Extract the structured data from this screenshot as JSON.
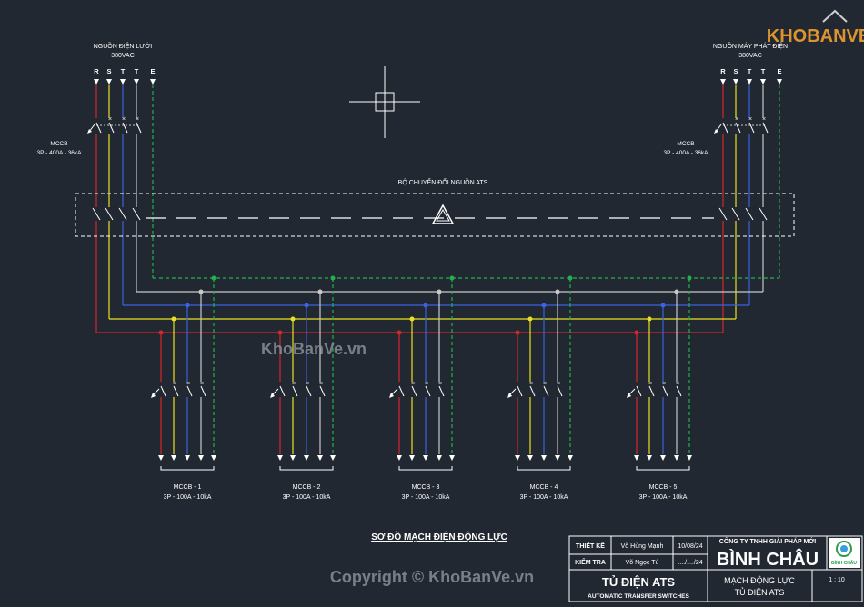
{
  "colors": {
    "background": "#222831",
    "R": "#d7262b",
    "S": "#e8e021",
    "T1": "#3b62e0",
    "T2": "#c8c8c8",
    "E": "#22b14c",
    "frame": "#ffffff"
  },
  "left_source": {
    "title": "NGUỒN ĐIỆN LƯỚI",
    "voltage": "380VAC",
    "phases": [
      "R",
      "S",
      "T",
      "T",
      "E"
    ],
    "breaker_name": "MCCB",
    "breaker_rating": "3P - 400A - 36kA"
  },
  "right_source": {
    "title": "NGUỒN MÁY PHÁT ĐIỆN",
    "voltage": "380VAC",
    "phases": [
      "R",
      "S",
      "T",
      "T",
      "E"
    ],
    "breaker_name": "MCCB",
    "breaker_rating": "3P - 400A - 36kA"
  },
  "ats_label": "BỘ CHUYỂN ĐỔI NGUỒN ATS",
  "outputs": [
    {
      "name": "MCCB - 1",
      "rating": "3P - 100A - 10kA"
    },
    {
      "name": "MCCB - 2",
      "rating": "3P - 100A - 10kA"
    },
    {
      "name": "MCCB - 3",
      "rating": "3P - 100A - 10kA"
    },
    {
      "name": "MCCB - 4",
      "rating": "3P - 100A - 10kA"
    },
    {
      "name": "MCCB - 5",
      "rating": "3P - 100A - 10kA"
    }
  ],
  "diagram_title": "SƠ ĐỒ MẠCH ĐIỆN ĐỘNG LỰC",
  "title_block": {
    "designer_label": "THIẾT KẾ",
    "designer_name": "Võ Hùng Mạnh",
    "designer_date": "10/08/24",
    "checker_label": "KIỂM TRA",
    "checker_name": "Võ Ngọc Tú",
    "checker_date": "..../..../24",
    "company_line": "CÔNG TY TNHH GIẢI PHÁP MỚI",
    "company_name": "BÌNH CHÂU",
    "logo_text": "BÌNH CHÂU",
    "project_title": "TỦ ĐIỆN ATS",
    "project_subtitle": "AUTOMATIC TRANSFER SWITCHES",
    "drawing_title_1": "MẠCH ĐỘNG LỰC",
    "drawing_title_2": "TỦ ĐIỆN ATS",
    "scale": "1 : 10"
  },
  "watermarks": {
    "logo": "KHOBANVE",
    "site": "KhoBanVe.vn",
    "copyright": "Copyright © KhoBanVe.vn"
  }
}
